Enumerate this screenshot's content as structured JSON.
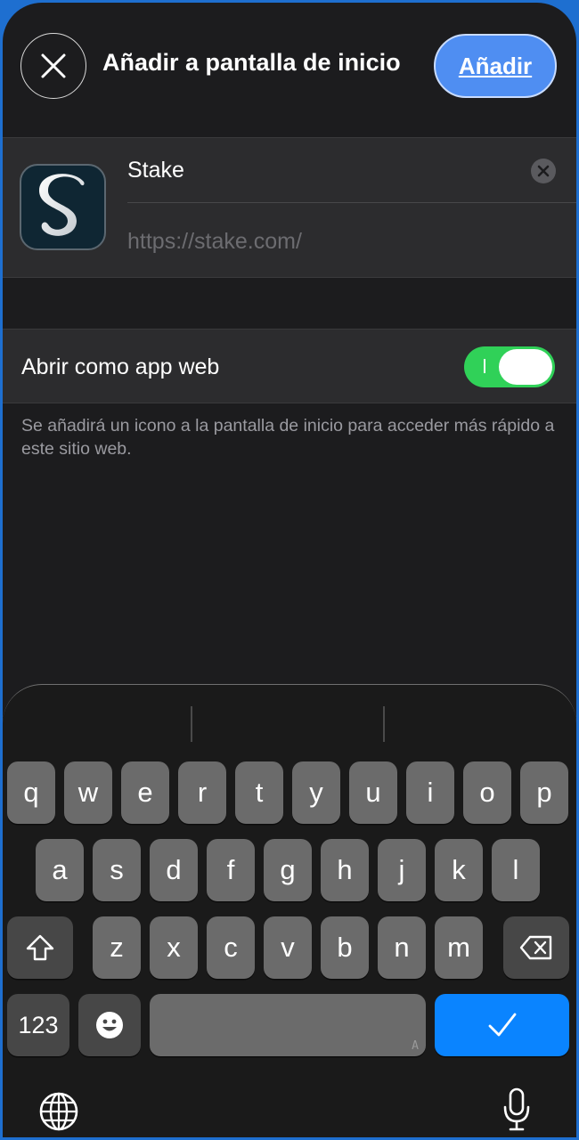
{
  "header": {
    "close_icon": "close-icon",
    "title": "Añadir a pantalla de inicio",
    "add_label": "Añadir"
  },
  "bookmark": {
    "app_icon_letter": "S",
    "name_value": "Stake",
    "url_value": "https://stake.com/",
    "clear_icon": "clear-circle-icon"
  },
  "web_app": {
    "label": "Abrir como app web",
    "toggle_on": true,
    "description": "Se añadirá un icono a la pantalla de inicio para acceder más rápido a este sitio web."
  },
  "keyboard": {
    "row1": [
      "q",
      "w",
      "e",
      "r",
      "t",
      "y",
      "u",
      "i",
      "o",
      "p"
    ],
    "row2": [
      "a",
      "s",
      "d",
      "f",
      "g",
      "h",
      "j",
      "k",
      "l"
    ],
    "row3": [
      "z",
      "x",
      "c",
      "v",
      "b",
      "n",
      "m"
    ],
    "numbers_label": "123",
    "space_hint": "A",
    "shift_icon": "shift-icon",
    "delete_icon": "backspace-icon",
    "emoji_icon": "emoji-icon",
    "done_icon": "checkmark-icon",
    "globe_icon": "globe-icon",
    "mic_icon": "microphone-icon"
  },
  "colors": {
    "accent": "#4f8ef2",
    "toggle_on": "#30d158",
    "done_key": "#0a84ff",
    "background": "#1c1c1e"
  }
}
